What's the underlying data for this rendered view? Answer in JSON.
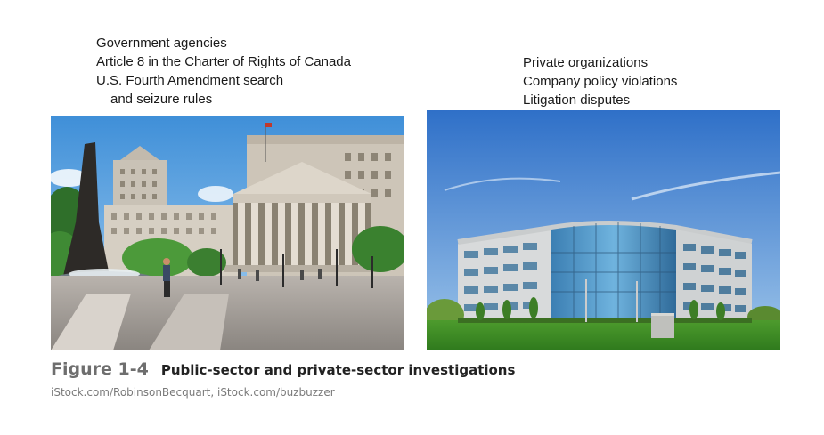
{
  "public_sector": {
    "items": [
      "Government agencies",
      "Article 8 in the Charter of Rights of Canada",
      "U.S. Fourth Amendment search",
      "and seizure rules"
    ]
  },
  "private_sector": {
    "items": [
      "Private organizations",
      "Company policy violations",
      "Litigation disputes"
    ]
  },
  "figure": {
    "number": "Figure 1-4",
    "title": "Public-sector and private-sector investigations",
    "credit": "iStock.com/RobinsonBecquart, iStock.com/buzbuzzer"
  },
  "colors": {
    "figure_number": "#6e6e6e",
    "credit": "#7a7a7a",
    "text": "#1a1a1a"
  }
}
